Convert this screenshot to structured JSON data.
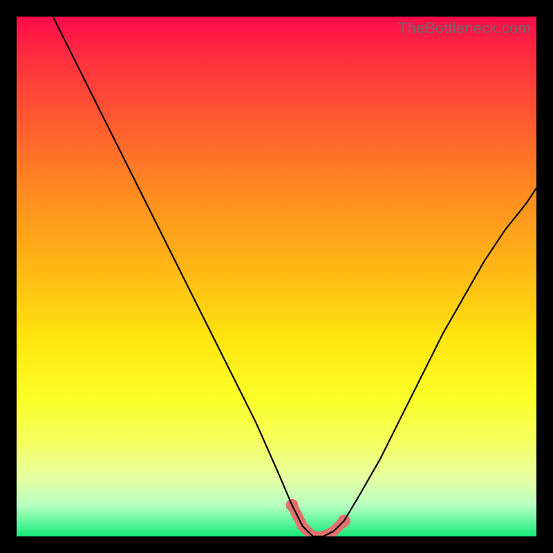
{
  "watermark": "TheBottleneck.com",
  "chart_data": {
    "type": "line",
    "title": "",
    "xlabel": "",
    "ylabel": "",
    "xlim": [
      0,
      100
    ],
    "ylim": [
      0,
      100
    ],
    "grid": false,
    "legend": false,
    "note": "V-shaped bottleneck curve over vertical red→green gradient. Minimum (0%) near x≈57. Highlighted pink segment marks the optimal low-bottleneck zone (~x 53–63).",
    "series": [
      {
        "name": "bottleneck-curve",
        "x": [
          7,
          10,
          14,
          18,
          22,
          26,
          30,
          34,
          38,
          42,
          46,
          50,
          53,
          55,
          57,
          59,
          61,
          63,
          66,
          70,
          74,
          78,
          82,
          86,
          90,
          94,
          98,
          100
        ],
        "y": [
          100,
          94,
          86,
          78,
          70,
          62,
          54,
          46,
          38,
          30,
          22,
          13,
          6,
          2,
          0,
          0,
          1,
          3,
          8,
          15,
          23,
          31,
          39,
          46,
          53,
          59,
          64,
          67
        ]
      }
    ],
    "highlight_range": {
      "x_start": 53,
      "x_end": 63
    },
    "gradient_stops": [
      {
        "pos": 0.0,
        "color": "#ff0a4a"
      },
      {
        "pos": 0.35,
        "color": "#ff8f1f"
      },
      {
        "pos": 0.62,
        "color": "#ffe50f"
      },
      {
        "pos": 0.9,
        "color": "#e6ffa5"
      },
      {
        "pos": 1.0,
        "color": "#17e87a"
      }
    ]
  }
}
